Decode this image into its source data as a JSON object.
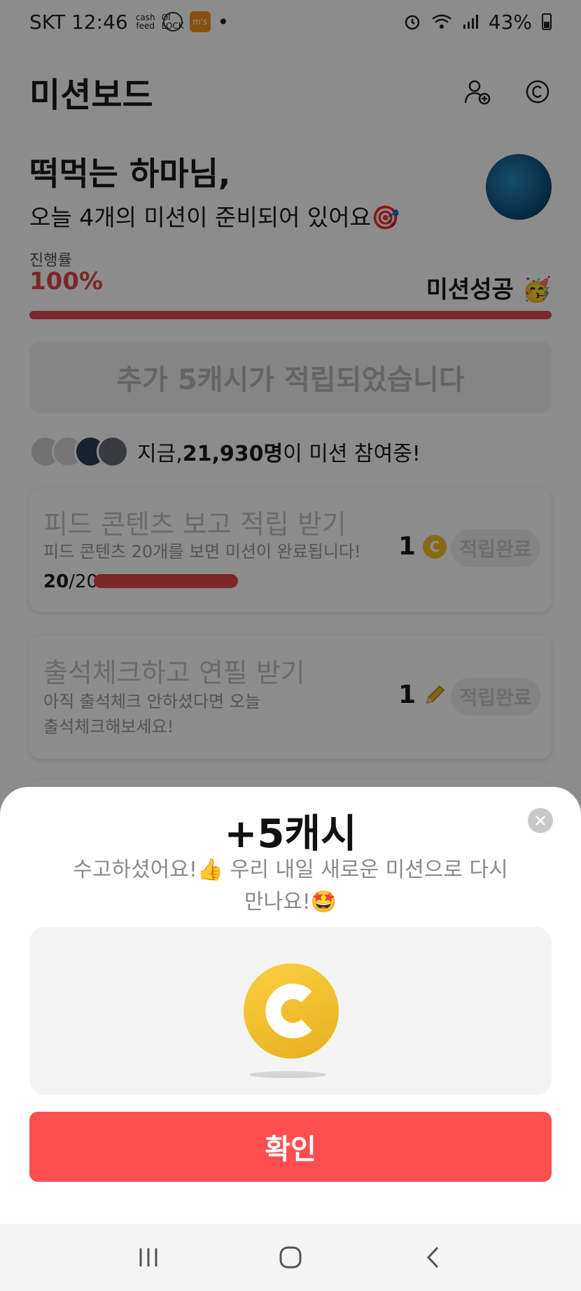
{
  "status_bar": {
    "carrier_time": "SKT 12:46",
    "icon_cashfeed": "cash feed",
    "icon_oilock": "OI LOCK",
    "icon_ms": "m's",
    "dot": "•",
    "battery": "43%"
  },
  "header": {
    "title": "미션보드",
    "add_friend_icon": "add-friend-icon",
    "cash_icon": "cash-icon"
  },
  "greeting": {
    "name": "떡먹는 하마님,",
    "subtitle": "오늘 4개의 미션이 준비되어 있어요🎯"
  },
  "progress": {
    "label": "진행률",
    "value_text": "100%",
    "value": 1.0,
    "status": "미션성공 🥳",
    "color": "#e2474d"
  },
  "banner": {
    "text": "추가 5캐시가 적립되었습니다"
  },
  "participants": {
    "prefix": "지금, ",
    "count": "21,930명",
    "suffix": "이 미션 참여중!"
  },
  "missions": [
    {
      "title": "피드 콘텐츠 보고 적립 받기",
      "desc": "피드 콘텐츠 20개를 보면 미션이 완료됩니다!",
      "reward": "1",
      "reward_icon": "coin-icon",
      "button": "적립완료",
      "progress_done": "20",
      "progress_total": "/20",
      "progress": 1.0
    },
    {
      "title": "출석체크하고 연필 받기",
      "desc_line1": "아직 출석체크 안하셨다면 오늘",
      "desc_line2": "출석체크해보세요!",
      "reward": "1",
      "reward_icon": "pencil-icon",
      "button": "적립완료"
    }
  ],
  "sheet": {
    "title": "+5캐시",
    "message_line1": "수고하셨어요!👍 우리 내일 새로운 미션으로 다시",
    "message_line2": "만나요!🤩",
    "confirm": "확인",
    "accent": "#ff4e50"
  },
  "navbar": {
    "recent": "recent-apps-icon",
    "home": "home-icon",
    "back": "back-icon"
  }
}
